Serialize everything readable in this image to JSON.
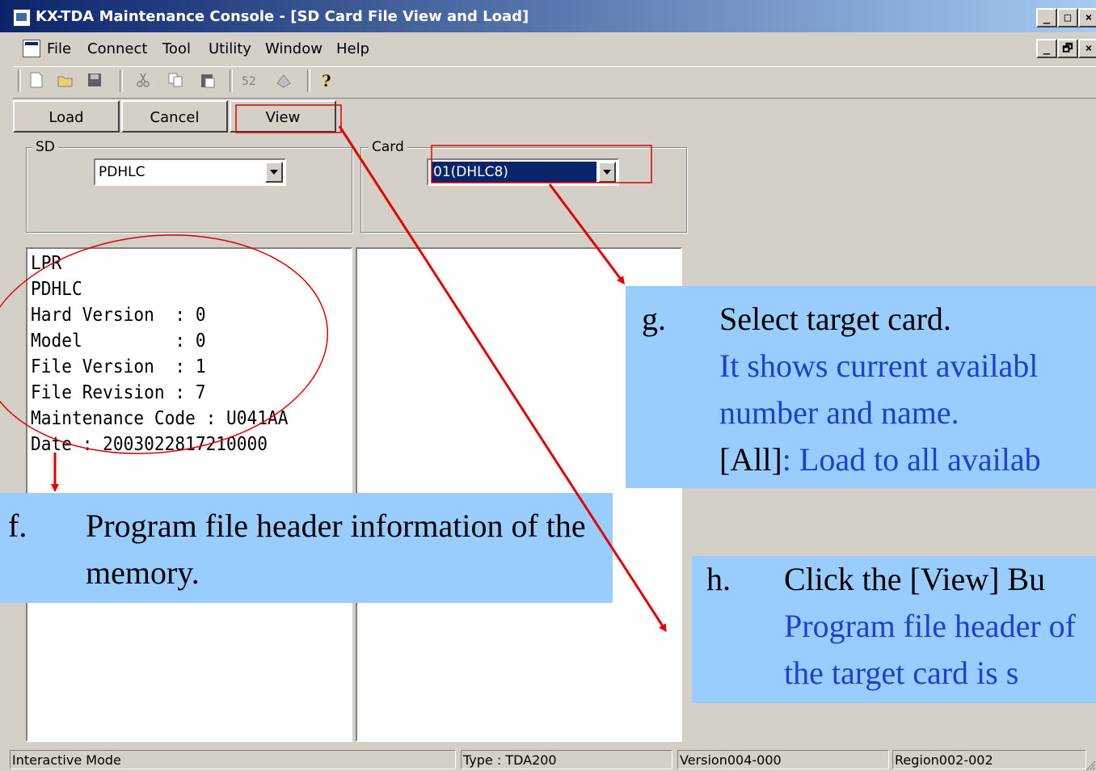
{
  "window": {
    "title": "KX-TDA Maintenance Console - [SD Card File View and Load]",
    "controls": [
      "_",
      "□",
      "×"
    ],
    "doc_controls": [
      "_",
      "🗗",
      "×"
    ]
  },
  "menu": [
    "File",
    "Connect",
    "Tool",
    "Utility",
    "Window",
    "Help"
  ],
  "toolbar": {
    "icons": [
      "new-icon",
      "open-icon",
      "save-icon",
      "cut-icon",
      "copy-icon",
      "paste-icon",
      "connect-icon",
      "disconnect-icon",
      "help-icon"
    ]
  },
  "buttons": {
    "load": "Load",
    "cancel": "Cancel",
    "view": "View"
  },
  "sd_group": {
    "label": "SD",
    "selected": "PDHLC"
  },
  "card_group": {
    "label": "Card",
    "selected": "01(DHLC8)"
  },
  "header_info": {
    "lines": [
      "LPR",
      "PDHLC",
      "Hard Version  : 0",
      "Model         : 0",
      "File Version  : 1",
      "File Revision : 7",
      "Maintenance Code : U041AA",
      "Date : 2003022817210000"
    ]
  },
  "annotations": {
    "f": {
      "letter": "f.",
      "text": "Program file header information of the memory."
    },
    "g": {
      "letter": "g.",
      "title": "Select target card.",
      "desc": "It shows current availabl number and name.",
      "all_bracket": "[All]",
      "all_text": ": Load to all availab"
    },
    "h": {
      "letter": "h.",
      "title": "Click the [View] Bu",
      "desc": "Program file header of the target card is s"
    }
  },
  "colors": {
    "callout_bg": "#99ccff",
    "highlight": "#e00000",
    "desc_text": "#1f3fd1"
  },
  "status": {
    "mode": "Interactive Mode",
    "type": "Type : TDA200",
    "version": "Version004-000",
    "region": "Region002-002"
  }
}
